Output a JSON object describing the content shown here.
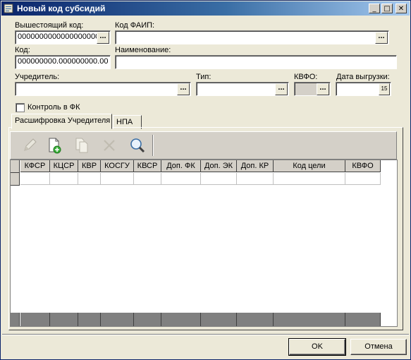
{
  "window": {
    "title": "Новый код субсидий"
  },
  "titlebar_buttons": {
    "minimize": "_",
    "maximize": "□",
    "close": "✕"
  },
  "form": {
    "parent_code_label": "Вышестоящий код:",
    "parent_code_value": "0000000000000000000",
    "faip_code_label": "Код ФАИП:",
    "faip_code_value": "",
    "code_label": "Код:",
    "code_value": "000000000.000000000.00",
    "name_label": "Наименование:",
    "name_value": "",
    "founder_label": "Учредитель:",
    "founder_value": "",
    "type_label": "Тип:",
    "type_value": "",
    "kvfo_label": "КВФО:",
    "kvfo_value": "",
    "export_date_label": "Дата выгрузки:",
    "export_date_value": "",
    "calendar_icon_text": "15",
    "fk_control_label": "Контроль в ФК",
    "fk_control_checked": false,
    "lookup_button_label": "..."
  },
  "tabs": [
    {
      "label": "Расшифровка Учредителя",
      "active": true
    },
    {
      "label": "НПА",
      "active": false
    }
  ],
  "toolbar": {
    "tools": [
      "edit-icon",
      "add-document-icon",
      "copy-document-icon",
      "delete-icon",
      "find-icon"
    ]
  },
  "table": {
    "columns": [
      "КФСР",
      "КЦСР",
      "КВР",
      "КОСГУ",
      "КВСР",
      "Доп. ФК",
      "Доп. ЭК",
      "Доп. КР",
      "Код цели",
      "КВФО"
    ]
  },
  "buttons": {
    "ok": "OK",
    "cancel": "Отмена"
  }
}
